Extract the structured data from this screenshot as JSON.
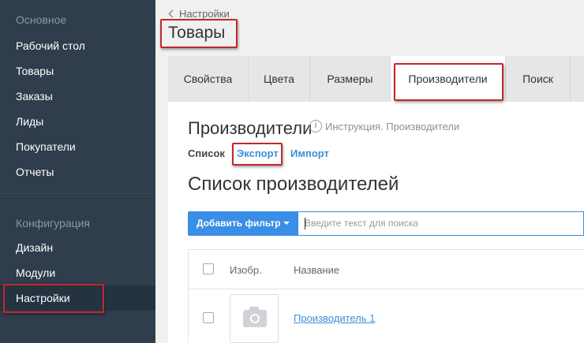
{
  "sidebar": {
    "group_main": "Основное",
    "items_main": [
      "Рабочий стол",
      "Товары",
      "Заказы",
      "Лиды",
      "Покупатели",
      "Отчеты"
    ],
    "group_config": "Конфигурация",
    "items_config": [
      "Дизайн",
      "Модули",
      "Настройки"
    ],
    "active": "Настройки"
  },
  "header": {
    "back_label": "Настройки",
    "title": "Товары"
  },
  "tabs": [
    "Свойства",
    "Цвета",
    "Размеры",
    "Производители",
    "Поиск"
  ],
  "active_tab": "Производители",
  "section": {
    "title": "Производители",
    "info_label": "Инструкция. Производители",
    "subnav": {
      "list": "Список",
      "export": "Экспорт",
      "import": "Импорт"
    },
    "list_title": "Список производителей"
  },
  "filter": {
    "button_label": "Добавить фильтр",
    "search_placeholder": "Введите текст для поиска"
  },
  "table": {
    "headers": {
      "image": "Изобр.",
      "name": "Название"
    },
    "rows": [
      {
        "name": "Производитель 1"
      }
    ]
  },
  "colors": {
    "highlight": "#c0282d",
    "accent": "#3a8ee6",
    "sidebar": "#2f3d4c"
  }
}
